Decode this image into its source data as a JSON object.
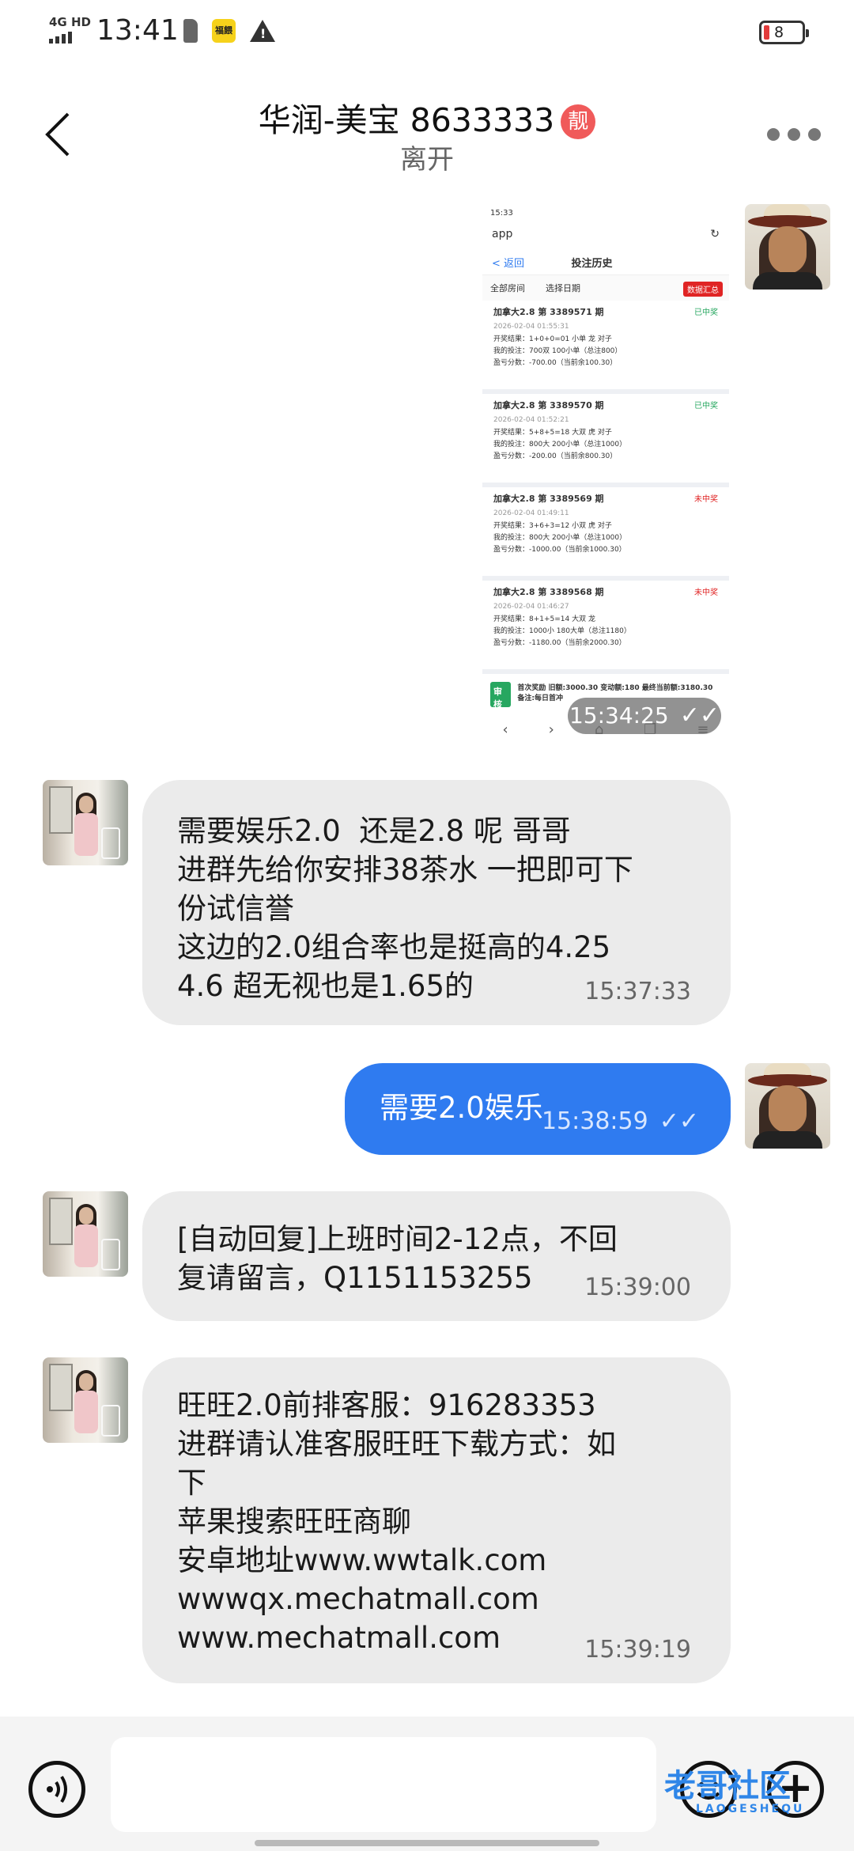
{
  "status_bar": {
    "network": "4G HD",
    "time": "13:41",
    "app_icon_text": "福餵",
    "battery": "8",
    "colors": {
      "battery_low": "#e23b3b"
    }
  },
  "header": {
    "title": "华润-美宝 8633333",
    "vip_badge": "靓",
    "subtitle": "离开"
  },
  "shared_image": {
    "status_time": "15:33",
    "app_label": "app",
    "nav_back": "< 返回",
    "nav_title": "投注历史",
    "filter_room": "全部房间",
    "filter_date": "选择日期",
    "summary_button": "数据汇总",
    "cards": [
      {
        "title": "加拿大2.8 第 3389571 期",
        "status": "已中奖",
        "date": "2026-02-04 01:55:31",
        "result": "开奖结果：1+0+0=01 小单 龙 对子",
        "bet": "我的投注：700双 100小单（总注800）",
        "profit": "盈亏分数：-700.00（当前余100.30）"
      },
      {
        "title": "加拿大2.8 第 3389570 期",
        "status": "已中奖",
        "date": "2026-02-04 01:52:21",
        "result": "开奖结果：5+8+5=18 大双 虎 对子",
        "bet": "我的投注：800大 200小单（总注1000）",
        "profit": "盈亏分数：-200.00（当前余800.30）"
      },
      {
        "title": "加拿大2.8 第 3389569 期",
        "status": "未中奖",
        "date": "2026-02-04 01:49:11",
        "result": "开奖结果：3+6+3=12 小双 虎 对子",
        "bet": "我的投注：800大 200小单（总注1000）",
        "profit": "盈亏分数：-1000.00（当前余1000.30）"
      },
      {
        "title": "加拿大2.8 第 3389568 期",
        "status": "未中奖",
        "date": "2026-02-04 01:46:27",
        "result": "开奖结果：8+1+5=14 大双 龙",
        "bet": "我的投注：1000小 180大单（总注1180）",
        "profit": "盈亏分数：-1180.00（当前余2000.30）"
      }
    ],
    "footer_badge": "审核",
    "footer_text": "首次奖励 旧额:3000.30 变动额:180 最终当前额:3180.30 备注:每日首冲",
    "timestamp": "15:34:25",
    "colors": {
      "won": "#27a760",
      "lost": "#e02424"
    }
  },
  "messages": [
    {
      "lines": [
        "需要娱乐2.0  还是2.8 呢 哥哥",
        "进群先给你安排38茶水 一把即可下",
        "份试信誉",
        "这边的2.0组合率也是挺高的4.25",
        "4.6 超无视也是1.65的"
      ],
      "time": "15:37:33"
    },
    {
      "lines": [
        "需要2.0娱乐"
      ],
      "time": "15:38:59"
    },
    {
      "lines": [
        "[自动回复]上班时间2-12点，不回",
        "复请留言，Q1151153255"
      ],
      "time": "15:39:00"
    },
    {
      "lines": [
        "旺旺2.0前排客服：916283353",
        "进群请认准客服旺旺下载方式：如",
        "下",
        "苹果搜索旺旺商聊",
        "安卓地址www.wwtalk.com",
        "wwwqx.mechatmall.com",
        "www.mechatmall.com"
      ],
      "time": "15:39:19"
    }
  ],
  "input": {
    "placeholder": ""
  },
  "watermark": {
    "main": "老哥社区",
    "sub": "LAOGESHEQU"
  },
  "colors": {
    "outgoing_bubble": "#2f7bf0",
    "incoming_bubble": "#ebebeb"
  }
}
